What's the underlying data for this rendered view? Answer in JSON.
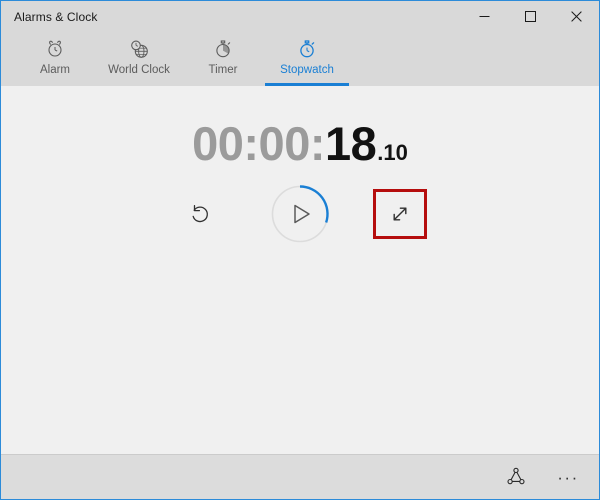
{
  "window": {
    "title": "Alarms & Clock",
    "accent_color": "#1a7fd4",
    "border_color": "#2c8bd9",
    "titlebar_color": "#d9d9d9",
    "content_color": "#f0f0f0",
    "controls": [
      {
        "name": "minimize",
        "glyph": "─",
        "label": "Minimize"
      },
      {
        "name": "maximize",
        "glyph": "☐",
        "label": "Maximize"
      },
      {
        "name": "close",
        "glyph": "✕",
        "label": "Close"
      }
    ]
  },
  "tabs": [
    {
      "id": "alarm",
      "label": "Alarm",
      "icon": "alarm-clock-icon",
      "active": false
    },
    {
      "id": "world-clock",
      "label": "World Clock",
      "icon": "globe-clock-icon",
      "active": false
    },
    {
      "id": "timer",
      "label": "Timer",
      "icon": "timer-icon",
      "active": false
    },
    {
      "id": "stopwatch",
      "label": "Stopwatch",
      "icon": "stopwatch-icon",
      "active": true
    }
  ],
  "stopwatch": {
    "hours_minutes": "00:00:",
    "seconds": "18",
    "fraction": ".10",
    "elapsed_seconds": 18.1,
    "progress_degrees": 108,
    "running": false,
    "ring_color": "#1a7fd4",
    "ring_track_color": "#dcdcdc",
    "reset_label": "Reset",
    "play_label": "Start",
    "expand_label": "Expand"
  },
  "highlight": {
    "target": "expand-button",
    "color": "#b50d0d"
  },
  "appbar": {
    "share_label": "Share",
    "more_label": "See more",
    "more_glyph": "···"
  }
}
